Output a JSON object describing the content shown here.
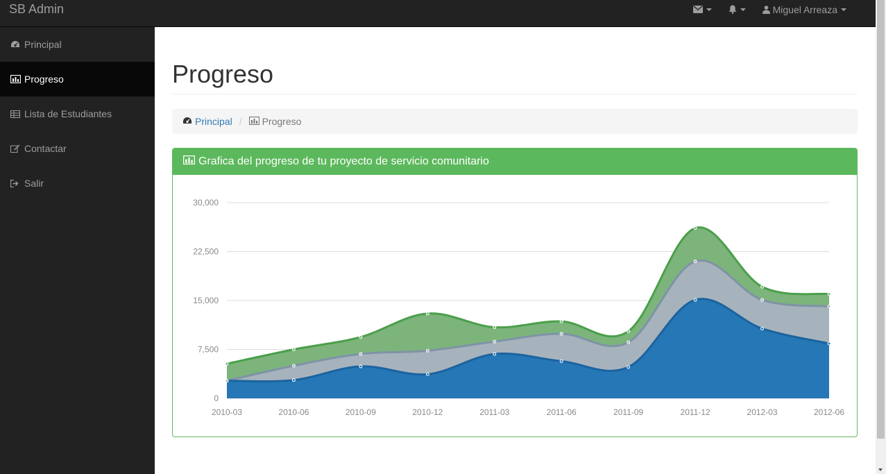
{
  "brand": "SB Admin",
  "topnav": {
    "messages_icon": "envelope-icon",
    "alerts_icon": "bell-icon",
    "user_name": "Miguel Arreaza"
  },
  "sidebar": {
    "items": [
      {
        "label": "Principal",
        "icon": "dashboard-icon",
        "active": false
      },
      {
        "label": "Progreso",
        "icon": "bar-chart-icon",
        "active": true
      },
      {
        "label": "Lista de Estudiantes",
        "icon": "table-icon",
        "active": false
      },
      {
        "label": "Contactar",
        "icon": "edit-icon",
        "active": false
      },
      {
        "label": "Salir",
        "icon": "sign-out-icon",
        "active": false
      }
    ]
  },
  "page": {
    "title": "Progreso",
    "breadcrumb": {
      "home": "Principal",
      "separator": "/",
      "current": "Progreso"
    }
  },
  "panel": {
    "title": "Grafica del progreso de tu proyecto de servicio comunitario"
  },
  "colors": {
    "accent_green": "#5cb85c",
    "link_blue": "#337ab7",
    "series_blue": "#2577b5",
    "series_gray": "#a7b3bc",
    "series_green": "#7cb47c"
  },
  "chart_data": {
    "type": "area",
    "stacked": true,
    "categories": [
      "2010-03",
      "2010-06",
      "2010-09",
      "2010-12",
      "2011-03",
      "2011-06",
      "2011-09",
      "2011-12",
      "2012-03",
      "2012-06"
    ],
    "series": [
      {
        "values": [
          2700,
          2800,
          4900,
          3700,
          6800,
          5700,
          4800,
          15100,
          10700,
          8400
        ],
        "color": "#2577b5"
      },
      {
        "values": [
          0,
          2200,
          1900,
          3600,
          1900,
          4200,
          3800,
          5900,
          4400,
          5700
        ],
        "color": "#a7b3bc"
      },
      {
        "values": [
          2600,
          2500,
          2600,
          5700,
          2200,
          1900,
          1700,
          5100,
          2000,
          1900
        ],
        "color": "#7cb47c"
      }
    ],
    "yticks": [
      "0",
      "7,500",
      "15,000",
      "22,500",
      "30,000"
    ],
    "ylim": [
      0,
      30000
    ],
    "grid": true,
    "legend": false
  }
}
